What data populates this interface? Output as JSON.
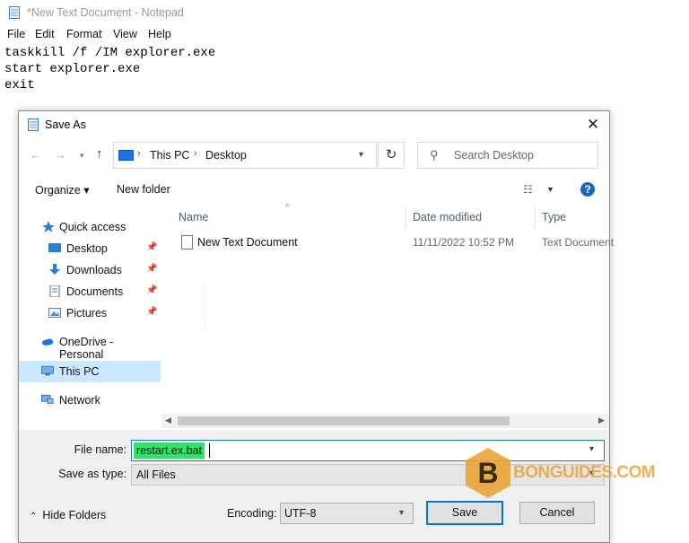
{
  "notepad": {
    "title": "*New Text Document - Notepad",
    "menu": [
      "File",
      "Edit",
      "Format",
      "View",
      "Help"
    ],
    "content": "taskkill /f /IM explorer.exe\nstart explorer.exe\nexit"
  },
  "dialog": {
    "title": "Save As",
    "close_glyph": "✕",
    "address": {
      "crumbs": [
        "This PC",
        "Desktop"
      ],
      "separator": "›"
    },
    "search_placeholder": "Search Desktop",
    "commands": {
      "organize": "Organize ▾",
      "new_folder": "New folder",
      "help": "?"
    },
    "nav": [
      {
        "label": "Quick access",
        "icon": "star-icon",
        "pinned": false
      },
      {
        "label": "Desktop",
        "icon": "desktop-icon",
        "pinned": true
      },
      {
        "label": "Downloads",
        "icon": "downloads-icon",
        "pinned": true
      },
      {
        "label": "Documents",
        "icon": "documents-icon",
        "pinned": true
      },
      {
        "label": "Pictures",
        "icon": "pictures-icon",
        "pinned": true
      },
      {
        "label": "OneDrive - Personal",
        "icon": "onedrive-icon",
        "pinned": false
      },
      {
        "label": "This PC",
        "icon": "this-pc-icon",
        "pinned": false,
        "selected": true
      },
      {
        "label": "Network",
        "icon": "network-icon",
        "pinned": false
      }
    ],
    "columns": {
      "name": "Name",
      "date": "Date modified",
      "type": "Type"
    },
    "files": [
      {
        "name": "New Text Document",
        "date": "11/11/2022 10:52 PM",
        "type": "Text Document"
      }
    ],
    "file_name_label": "File name:",
    "file_name_value": "restart.ex.bat",
    "save_as_type_label": "Save as type:",
    "save_as_type_value": "All Files",
    "hide_folders": "Hide Folders",
    "encoding_label": "Encoding:",
    "encoding_value": "UTF-8",
    "save_button": "Save",
    "cancel_button": "Cancel"
  },
  "watermark": {
    "letter": "B",
    "text": "BONGUIDES.COM",
    "color": "#e9a339"
  },
  "colors": {
    "accent": "#0078d7",
    "selected_nav": "#cce8ff",
    "filename_highlight": "#2ee56a"
  }
}
